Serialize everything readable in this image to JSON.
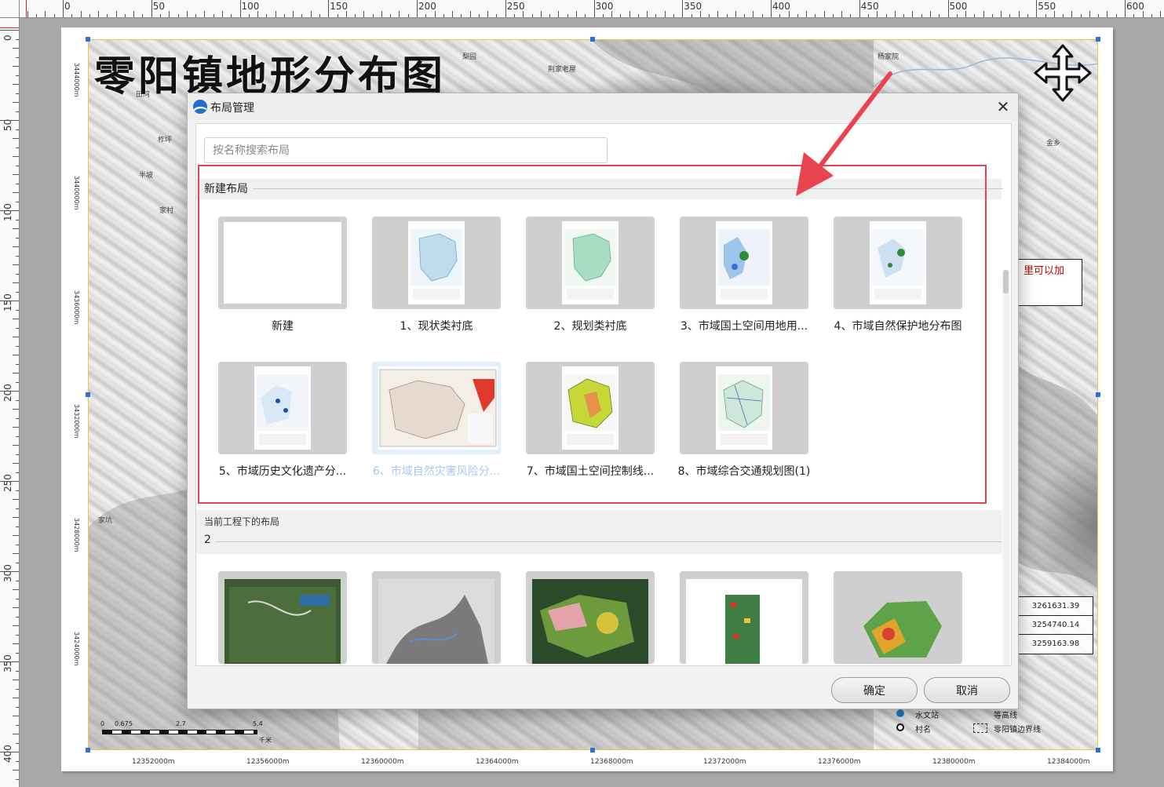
{
  "ruler": {
    "top_labels": [
      "0",
      "50",
      "100",
      "150",
      "200",
      "250",
      "300",
      "350",
      "400",
      "450",
      "500",
      "550",
      "600"
    ],
    "left_labels": [
      "0",
      "50",
      "100",
      "150",
      "200",
      "250",
      "300",
      "350",
      "400"
    ]
  },
  "map": {
    "title": "零阳镇地形分布图",
    "x_coords": [
      "12352000m",
      "12356000m",
      "12360000m",
      "12364000m",
      "12368000m",
      "12372000m",
      "12376000m",
      "12380000m",
      "12384000m"
    ],
    "y_coords": [
      "3444000m",
      "3440000m",
      "3436000m",
      "3432000m",
      "3428000m",
      "3424000m"
    ],
    "note_text": "里可以加",
    "table_values": [
      "3261631.39",
      "3254740.14",
      "3259163.98"
    ],
    "scalebar": {
      "ticks": [
        "0",
        "0.675",
        "2.7",
        "5.4"
      ],
      "unit": "千米"
    },
    "legend": [
      {
        "icon": "hydrology-station-icon",
        "label": "水文站"
      },
      {
        "icon": "village-icon",
        "label": "村名"
      },
      {
        "icon": "contour-line-icon",
        "label": "等高线"
      },
      {
        "icon": "boundary-line-icon",
        "label": "零阳镇边界线"
      }
    ],
    "place_labels": [
      "梨园",
      "杨家院",
      "荆家老屋",
      "田湾",
      "柞坪",
      "半坡",
      "家村",
      "金乡",
      "家坑"
    ]
  },
  "dialog": {
    "title": "布局管理",
    "search_placeholder": "按名称搜索布局",
    "section_new": "新建布局",
    "section_current": "当前工程下的布局",
    "current_count": "2",
    "new_layouts": [
      {
        "label": "新建",
        "thumb": "blank"
      },
      {
        "label": "1、现状类衬底",
        "thumb": "blue-map"
      },
      {
        "label": "2、规划类衬底",
        "thumb": "green-map"
      },
      {
        "label": "3、市域国土空间用地用...",
        "thumb": "landuse-map"
      },
      {
        "label": "4、市域自然保护地分布图",
        "thumb": "protected-map"
      },
      {
        "label": "5、市域历史文化遗产分...",
        "thumb": "heritage-map"
      },
      {
        "label": "6、市域自然灾害风险分...",
        "thumb": "disaster-map",
        "selected": true
      },
      {
        "label": "7、市域国土空间控制线...",
        "thumb": "control-map"
      },
      {
        "label": "8、市域综合交通规划图(1)",
        "thumb": "traffic-map"
      }
    ],
    "project_layouts": [
      {
        "thumb": "satellite-town"
      },
      {
        "thumb": "terrain-relief"
      },
      {
        "thumb": "china-vegetation"
      },
      {
        "thumb": "elevation-analysis"
      },
      {
        "thumb": "province-analysis"
      }
    ],
    "ok_label": "确定",
    "cancel_label": "取消"
  },
  "colors": {
    "accent": "#2a6fdb",
    "highlight": "#e8434f",
    "selected_tile": "#e2eefb"
  }
}
